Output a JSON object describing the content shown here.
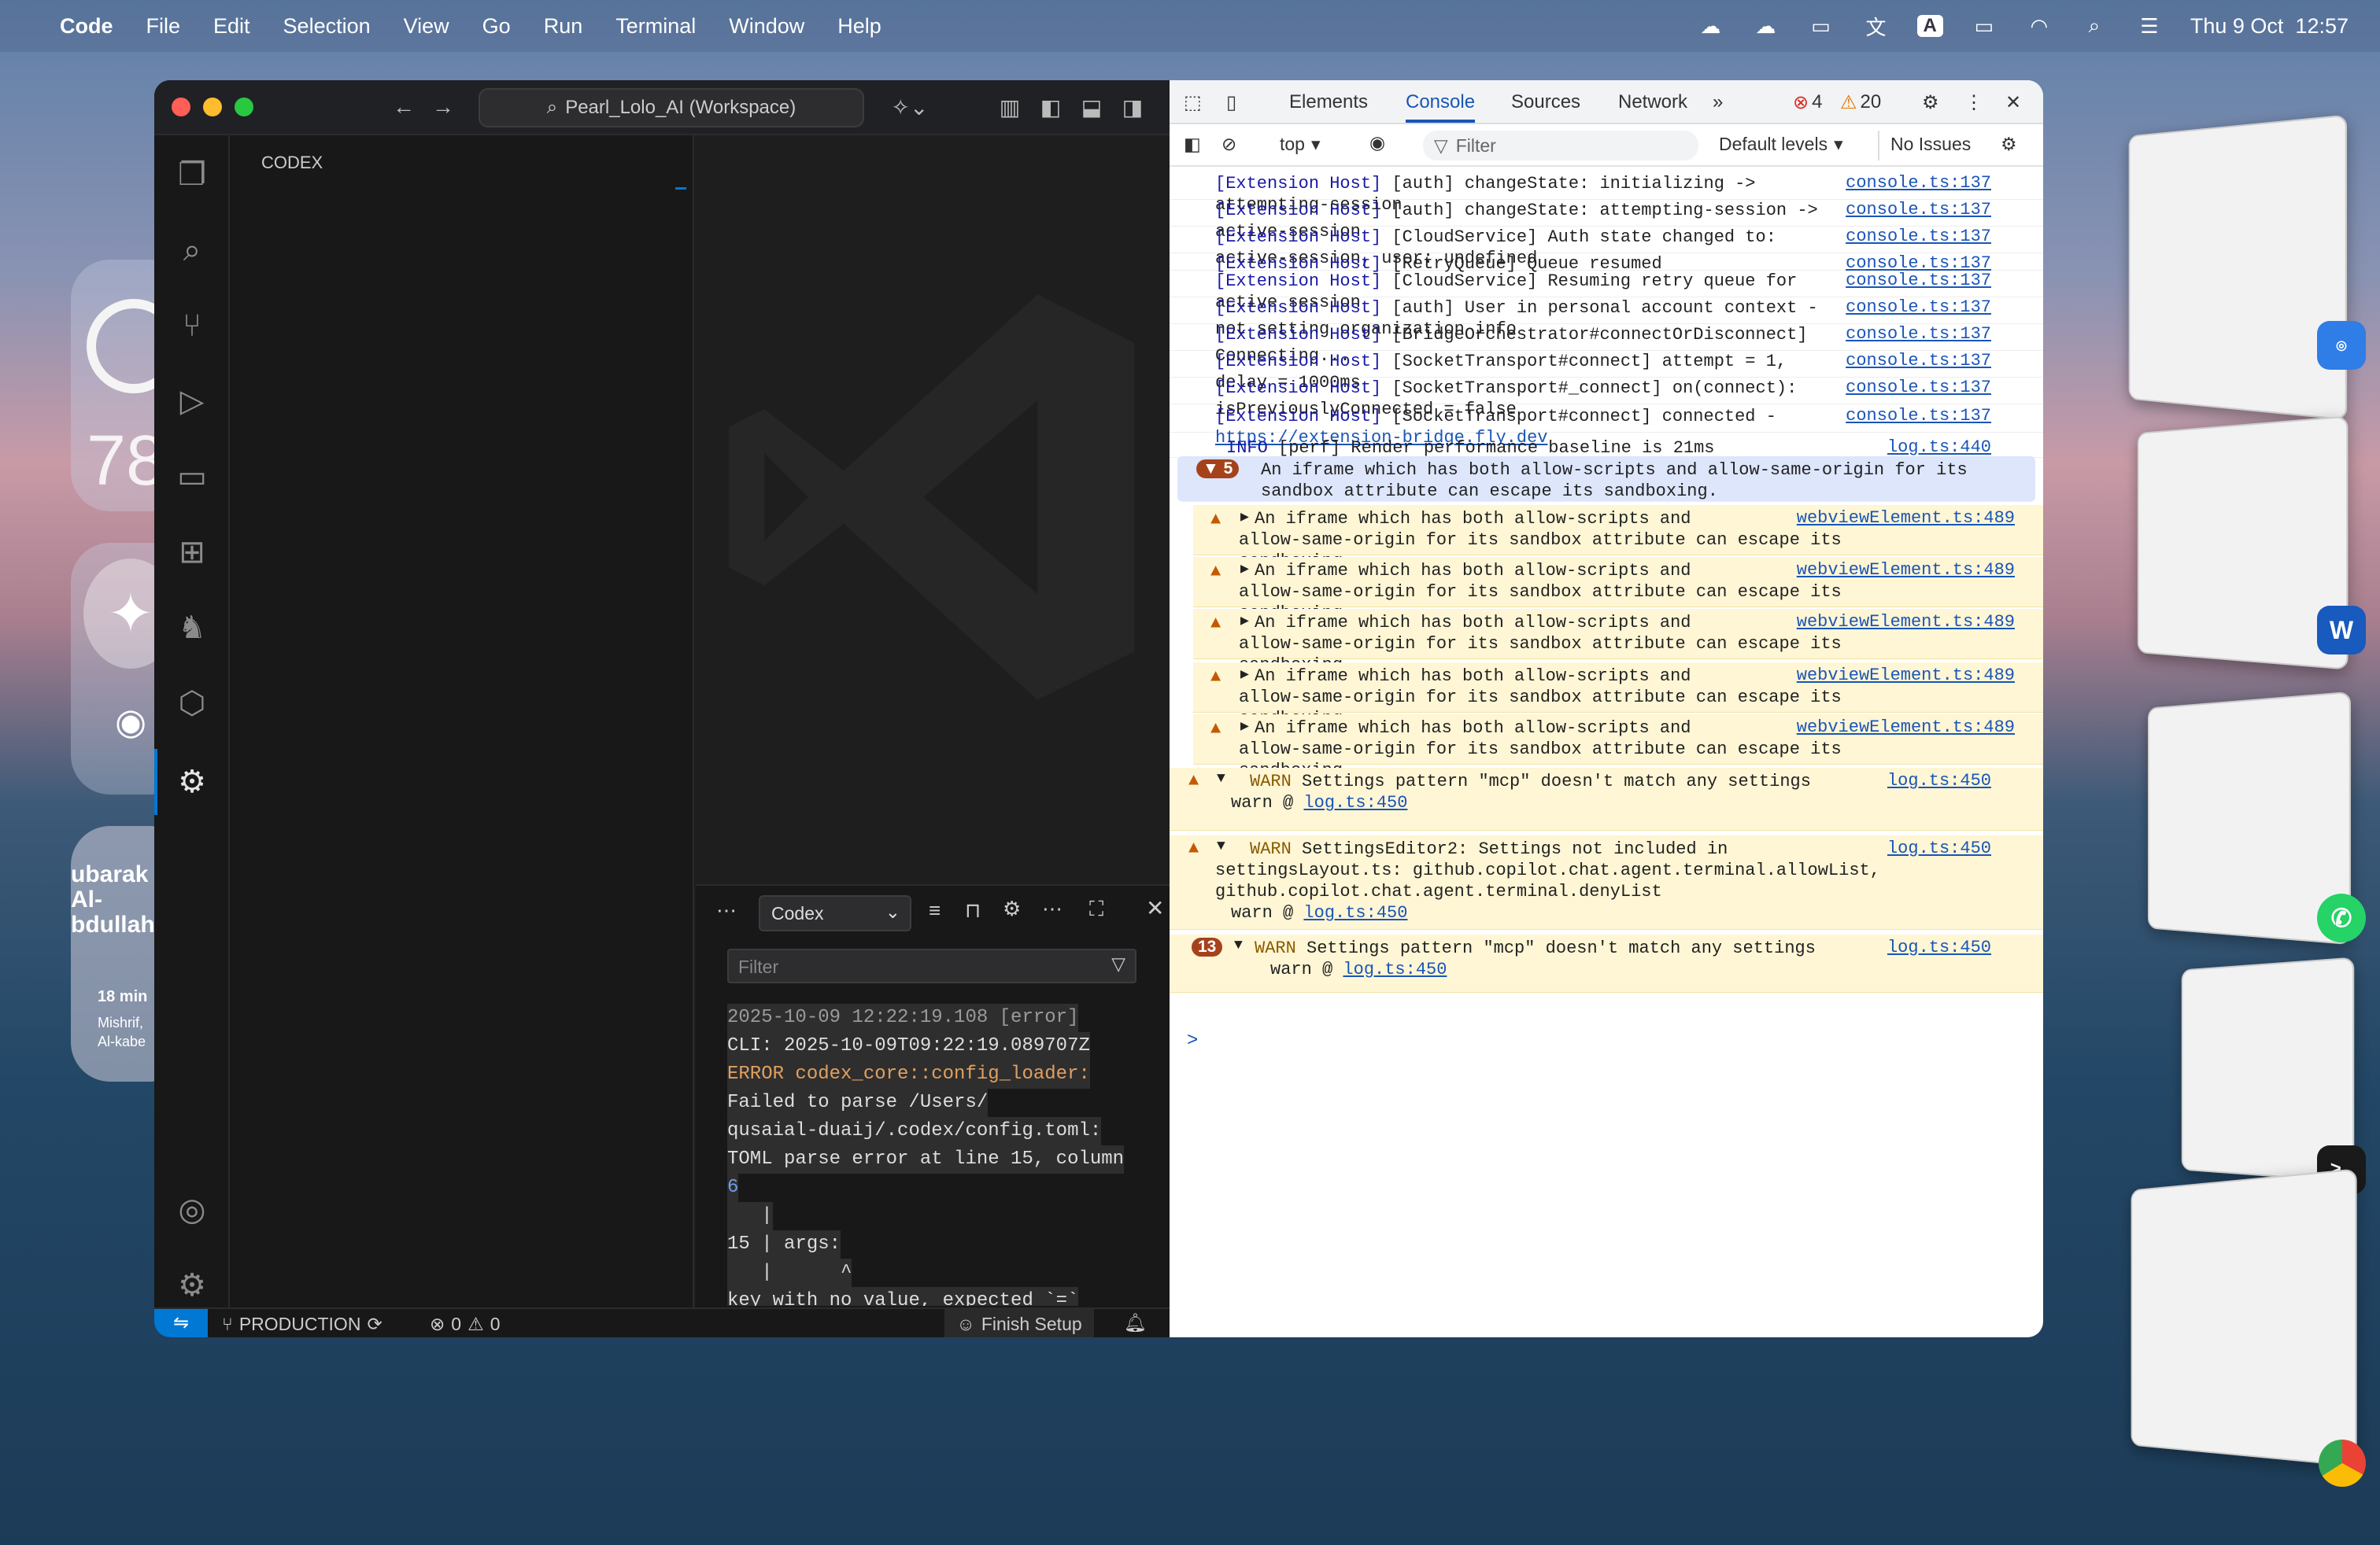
{
  "menubar": {
    "app": "Code",
    "items": [
      "File",
      "Edit",
      "Selection",
      "View",
      "Go",
      "Run",
      "Terminal",
      "Window",
      "Help"
    ],
    "input_source": "A",
    "clock": "Thu 9 Oct  12:57"
  },
  "widgets": {
    "weather_temp": "78",
    "contact_name_1": "ubarak",
    "contact_name_2": "Al-",
    "contact_name_3": "bdullah",
    "eta": "18 min",
    "loc_1": "Mishrif,",
    "loc_2": "Al-kabe"
  },
  "vscode": {
    "command_center": "Pearl_Lolo_AI (Workspace)",
    "sidebar_title": "CODEX",
    "panel": {
      "dropdown": "Codex",
      "filter_placeholder": "Filter",
      "lines": [
        "2025-10-09 12:22:19.108 [error]",
        "CLI: 2025-10-09T09:22:19.089707Z",
        "ERROR codex_core::config_loader:",
        "Failed to parse /Users/",
        "qusaial-duaij/.codex/config.toml:",
        "TOML parse error at line 15, column",
        "6",
        "   |",
        "15 | args:",
        "   |      ^",
        "key with no value, expected `=`"
      ]
    },
    "status": {
      "branch": "PRODUCTION",
      "errors": "0",
      "warnings": "0",
      "finish_setup": "Finish Setup"
    }
  },
  "devtools": {
    "tabs": [
      "Elements",
      "Console",
      "Sources",
      "Network"
    ],
    "active_tab": "Console",
    "error_count": "4",
    "warning_count": "20",
    "context": "top",
    "filter_placeholder": "Filter",
    "levels": "Default levels",
    "issues": "No Issues",
    "logs": [
      {
        "prefix": "[Extension Host]",
        "text": " [auth] changeState: initializing ->\nattempting-session",
        "src": "console.ts:137"
      },
      {
        "prefix": "[Extension Host]",
        "text": " [auth] changeState: attempting-session ->\nactive-session",
        "src": "console.ts:137"
      },
      {
        "prefix": "[Extension Host]",
        "text": " [CloudService] Auth state changed to:\nactive-session, user: undefined",
        "src": "console.ts:137"
      },
      {
        "prefix": "[Extension Host]",
        "text": " [RetryQueue] Queue resumed",
        "src": "console.ts:137"
      },
      {
        "prefix": "[Extension Host]",
        "text": " [CloudService] Resuming retry queue for\nactive session",
        "src": "console.ts:137"
      },
      {
        "prefix": "[Extension Host]",
        "text": " [auth] User in personal account context -\nnot setting organization info",
        "src": "console.ts:137"
      },
      {
        "prefix": "[Extension Host]",
        "text": " [BridgeOrchestrator#connectOrDisconnect]\nConnecting...",
        "src": "console.ts:137"
      },
      {
        "prefix": "[Extension Host]",
        "text": " [SocketTransport#connect] attempt = 1,\ndelay = 1000ms",
        "src": "console.ts:137"
      },
      {
        "prefix": "[Extension Host]",
        "text": " [SocketTransport#_connect] on(connect):\nisPreviouslyConnected = false",
        "src": "console.ts:137"
      },
      {
        "prefix": "[Extension Host]",
        "text": " [SocketTransport#connect] connected -",
        "link": "https://extension-bridge.fly.dev",
        "src": "console.ts:137"
      }
    ],
    "info": {
      "level": "INFO",
      "text": "[perf] Render performance baseline is 21ms",
      "src": "log.ts:440"
    },
    "group": {
      "count": "5",
      "text": "An iframe which has both allow-scripts and allow-same-origin for its\nsandbox attribute can escape its sandboxing."
    },
    "iframe_warn": {
      "text": "An iframe which has both allow-scripts and\nallow-same-origin for its sandbox attribute can escape its sandboxing.",
      "src": "webviewElement.ts:489"
    },
    "warn1": {
      "level": "WARN",
      "text": "Settings pattern \"mcp\" doesn't match any settings",
      "src": "log.ts:450",
      "at": "warn @ ",
      "at_link": "log.ts:450"
    },
    "warn2": {
      "level": "WARN",
      "text": "SettingsEditor2: Settings not included in\nsettingsLayout.ts: github.copilot.chat.agent.terminal.allowList,\ngithub.copilot.chat.agent.terminal.denyList",
      "src": "log.ts:450",
      "at": "warn @ ",
      "at_link": "log.ts:450"
    },
    "warn3": {
      "count": "13",
      "level": "WARN",
      "text": "Settings pattern \"mcp\" doesn't match any settings",
      "src": "log.ts:450",
      "at": "warn @ ",
      "at_link": "log.ts:450"
    },
    "prompt": ">"
  },
  "colors": {
    "accent": "#0078d4",
    "error": "#d93025",
    "warn": "#e37400",
    "link": "#1a55b8"
  }
}
